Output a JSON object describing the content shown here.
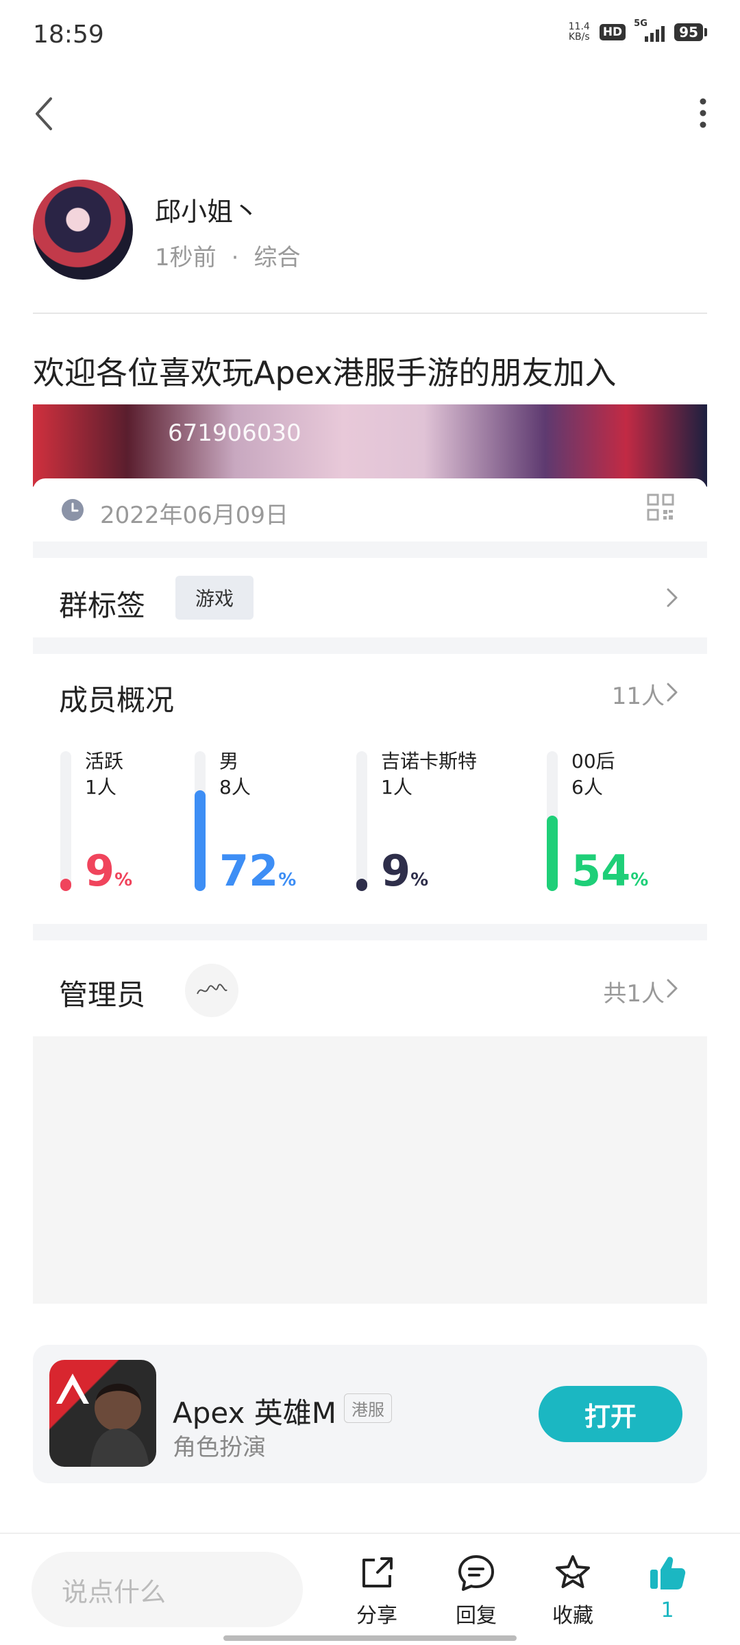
{
  "status_bar": {
    "time": "18:59",
    "net_speed_value": "11.4",
    "net_speed_unit": "KB/s",
    "hd": "HD",
    "network": "5G",
    "battery": "95"
  },
  "post": {
    "author": "邱小姐丶",
    "time_ago": "1秒前",
    "separator": "·",
    "category": "综合",
    "title": "欢迎各位喜欢玩Apex港服手游的朋友加入"
  },
  "group_card": {
    "group_number": "671906030",
    "date": "2022年06月09日"
  },
  "tags_section": {
    "label": "群标签",
    "tag": "游戏"
  },
  "members_section": {
    "label": "成员概况",
    "count": "11人",
    "stats": [
      {
        "label": "活跃",
        "count": "1人",
        "percent": "9",
        "unit": "%",
        "fraction": 0.09,
        "color": "#f0445c"
      },
      {
        "label": "男",
        "count": "8人",
        "percent": "72",
        "unit": "%",
        "fraction": 0.72,
        "color": "#3d8ef5"
      },
      {
        "label": "吉诺卡斯特",
        "count": "1人",
        "percent": "9",
        "unit": "%",
        "fraction": 0.09,
        "color": "#2e2e4a"
      },
      {
        "label": "00后",
        "count": "6人",
        "percent": "54",
        "unit": "%",
        "fraction": 0.54,
        "color": "#1ecf78"
      }
    ]
  },
  "admin_section": {
    "label": "管理员",
    "count": "共1人"
  },
  "app_card": {
    "name": "Apex 英雄M",
    "badge": "港服",
    "category": "角色扮演",
    "open_label": "打开",
    "button_color": "#1bb7c2"
  },
  "bottom_bar": {
    "comment_placeholder": "说点什么",
    "share_label": "分享",
    "reply_label": "回复",
    "favorite_label": "收藏",
    "like_count": "1",
    "like_color": "#1bb7c2"
  }
}
